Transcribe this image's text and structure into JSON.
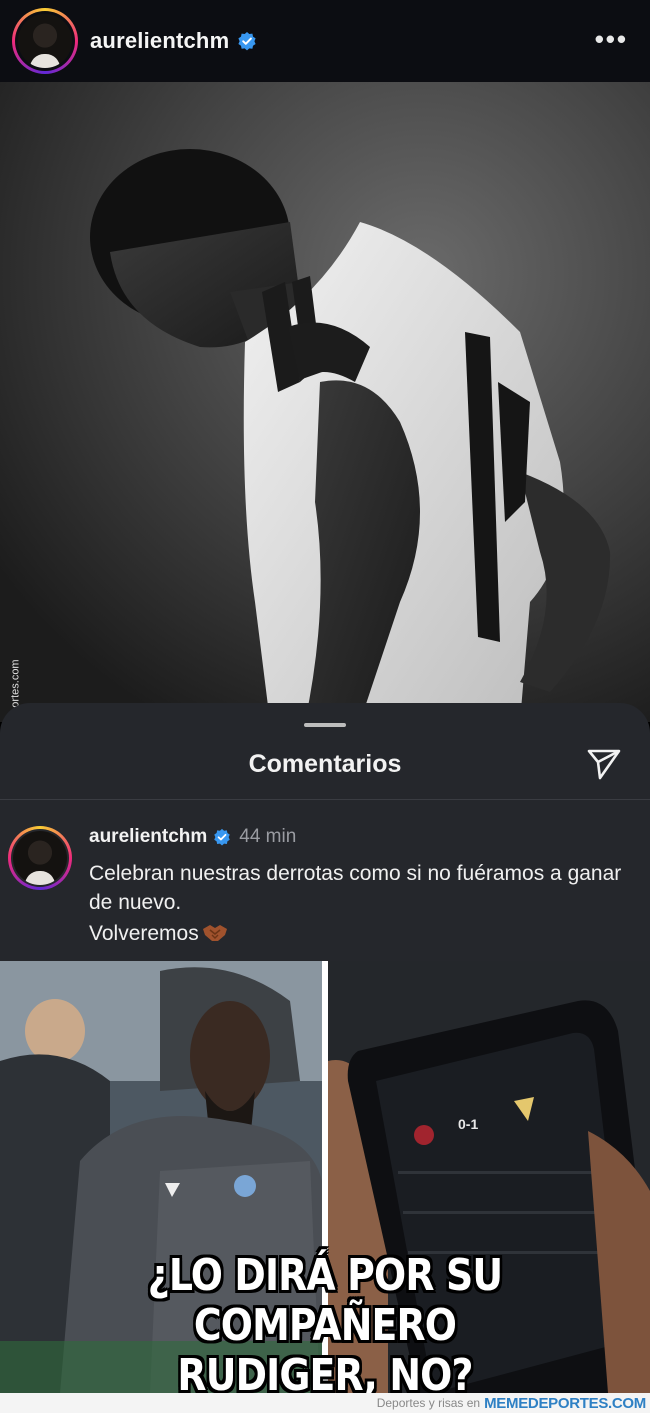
{
  "header": {
    "username": "aurelientchm",
    "verified": true,
    "more_icon": "more-horizontal-icon"
  },
  "post": {
    "photo_description_icon": "player-photo",
    "side_watermark": "Memedeportes.com"
  },
  "comments_sheet": {
    "title": "Comentarios",
    "send_icon": "send-icon",
    "comment": {
      "username": "aurelientchm",
      "verified": true,
      "time": "44 min",
      "text": "Celebran nuestras derrotas como si no fuéramos a ganar de nuevo.",
      "text_line2": "Volveremos",
      "emoji": "handshake-icon"
    }
  },
  "meme": {
    "caption_line1": "¿LO DIRÁ POR SU COMPAÑERO",
    "caption_line2": "RUDIGER, NO?",
    "phone_score": "0-1"
  },
  "footer": {
    "small_text": "Deportes y risas en",
    "brand": "MEMEDEPORTES.COM"
  },
  "colors": {
    "header_bg": "#0c0d12",
    "sheet_bg": "#25272c",
    "verified_blue": "#3897f0",
    "brand_blue": "#2e80c4"
  }
}
